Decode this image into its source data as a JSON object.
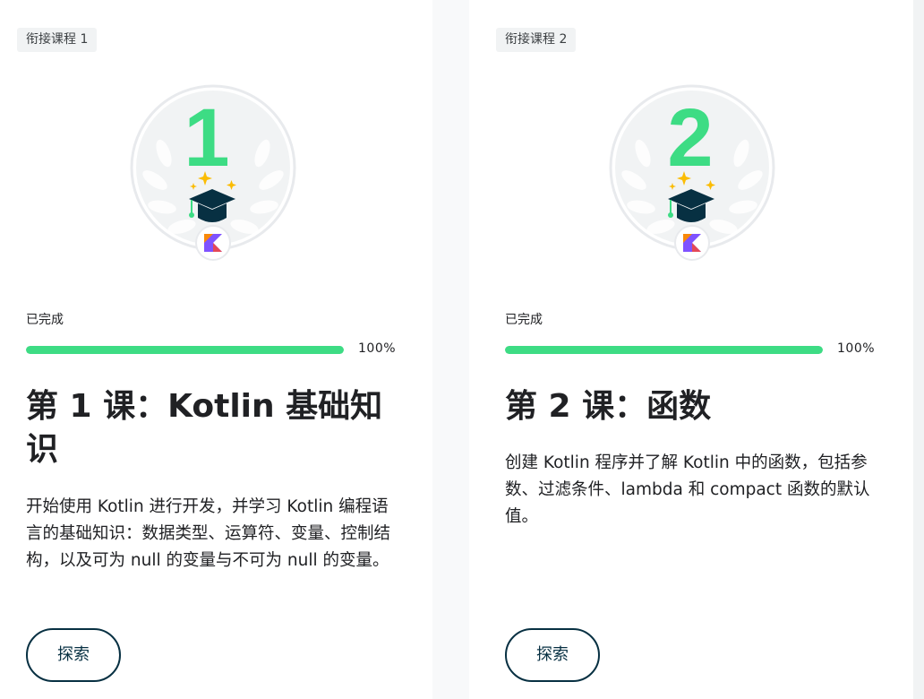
{
  "accent": "#3ddc84",
  "courses": [
    {
      "chip": "衔接课程 1",
      "badge_number": "1",
      "badge_icons": [
        "laurel-wreath-icon",
        "graduation-cap-icon",
        "sparkle-icon",
        "kotlin-logo-icon"
      ],
      "status": "已完成",
      "progress": 1.0,
      "progress_label": "100%",
      "title": "第 1 课：Kotlin 基础知识",
      "description": "开始使用 Kotlin 进行开发，并学习 Kotlin 编程语言的基础知识：数据类型、运算符、变量、控制结构，以及可为 null 的变量与不可为 null 的变量。",
      "button": "探索"
    },
    {
      "chip": "衔接课程 2",
      "badge_number": "2",
      "badge_icons": [
        "laurel-wreath-icon",
        "graduation-cap-icon",
        "sparkle-icon",
        "kotlin-logo-icon"
      ],
      "status": "已完成",
      "progress": 1.0,
      "progress_label": "100%",
      "title": "第 2 课：函数",
      "description": "创建 Kotlin 程序并了解 Kotlin 中的函数，包括参数、过滤条件、lambda 和 compact 函数的默认值。",
      "button": "探索"
    }
  ]
}
